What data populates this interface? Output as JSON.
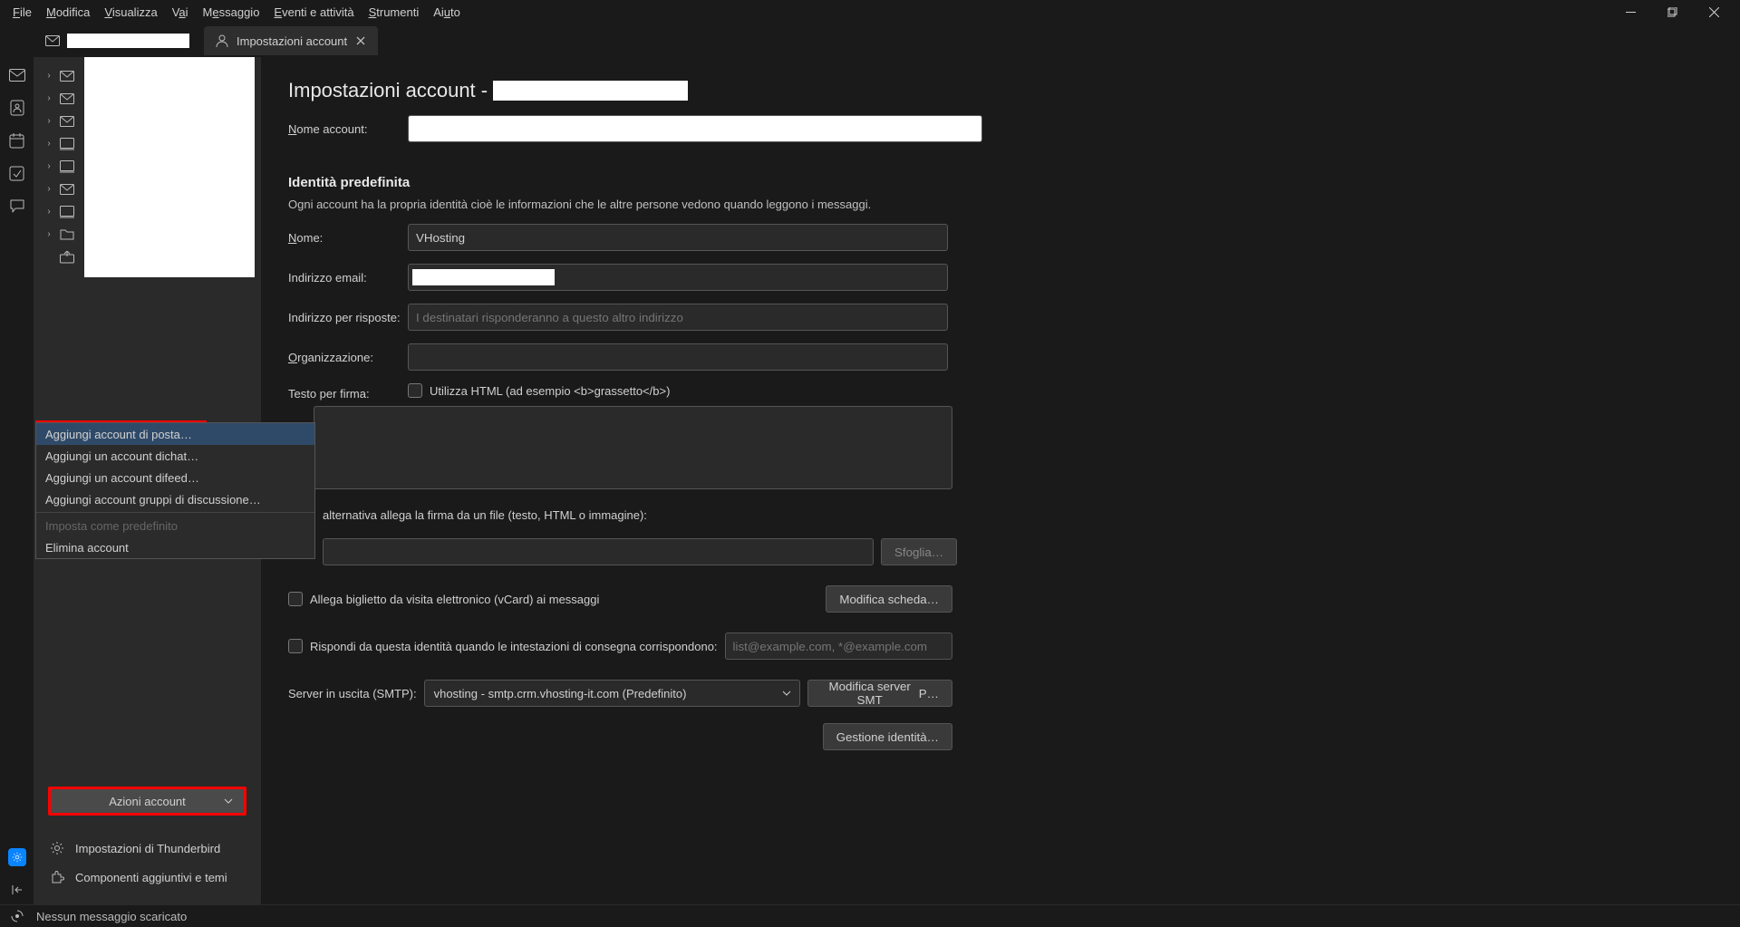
{
  "menubar": {
    "items": [
      "File",
      "Modifica",
      "Visualizza",
      "Vai",
      "Messaggio",
      "Eventi e attività",
      "Strumenti",
      "Aiuto"
    ]
  },
  "tabs": {
    "mail_tab_icon": "mail",
    "settings_tab_label": "Impostazioni account"
  },
  "content": {
    "page_title_prefix": "Impostazioni account - ",
    "account_name_label": "Nome account:",
    "identity_header": "Identità predefinita",
    "identity_desc": "Ogni account ha la propria identità cioè le informazioni che le altre persone vedono quando leggono i messaggi.",
    "name_label": "Nome:",
    "name_value": "VHosting",
    "email_label": "Indirizzo email:",
    "reply_label": "Indirizzo per risposte:",
    "reply_placeholder": "I destinatari risponderanno a questo altro indirizzo",
    "org_label": "Organizzazione:",
    "sig_label": "Testo per firma:",
    "use_html_label": "Utilizza HTML (ad esempio <b>grassetto</b>)",
    "alt_sig_label": "alternativa allega la firma da un file (testo, HTML o immagine):",
    "browse_btn": "Sfoglia…",
    "vcard_label": "Allega biglietto da visita elettronico (vCard) ai messaggi",
    "edit_card_btn": "Modifica scheda…",
    "reply_from_label": "Rispondi da questa identità quando le intestazioni di consegna corrispondono:",
    "reply_from_placeholder": "list@example.com, *@example.com",
    "smtp_label": "Server in uscita (SMTP):",
    "smtp_value": "vhosting - smtp.crm.vhosting-it.com (Predefinito)",
    "edit_smtp_btn": "Modifica server SMTP…",
    "manage_identities_btn": "Gestione identità…"
  },
  "sidebar": {
    "actions_btn_label": "Azioni account",
    "thunderbird_settings": "Impostazioni di Thunderbird",
    "addons": "Componenti aggiuntivi e temi"
  },
  "context_menu": {
    "items": [
      "Aggiungi account di posta…",
      "Aggiungi un account di chat…",
      "Aggiungi un account di feed…",
      "Aggiungi account gruppi di discussione…",
      "Imposta come predefinito",
      "Elimina account"
    ]
  },
  "statusbar": {
    "text": "Nessun messaggio scaricato"
  }
}
